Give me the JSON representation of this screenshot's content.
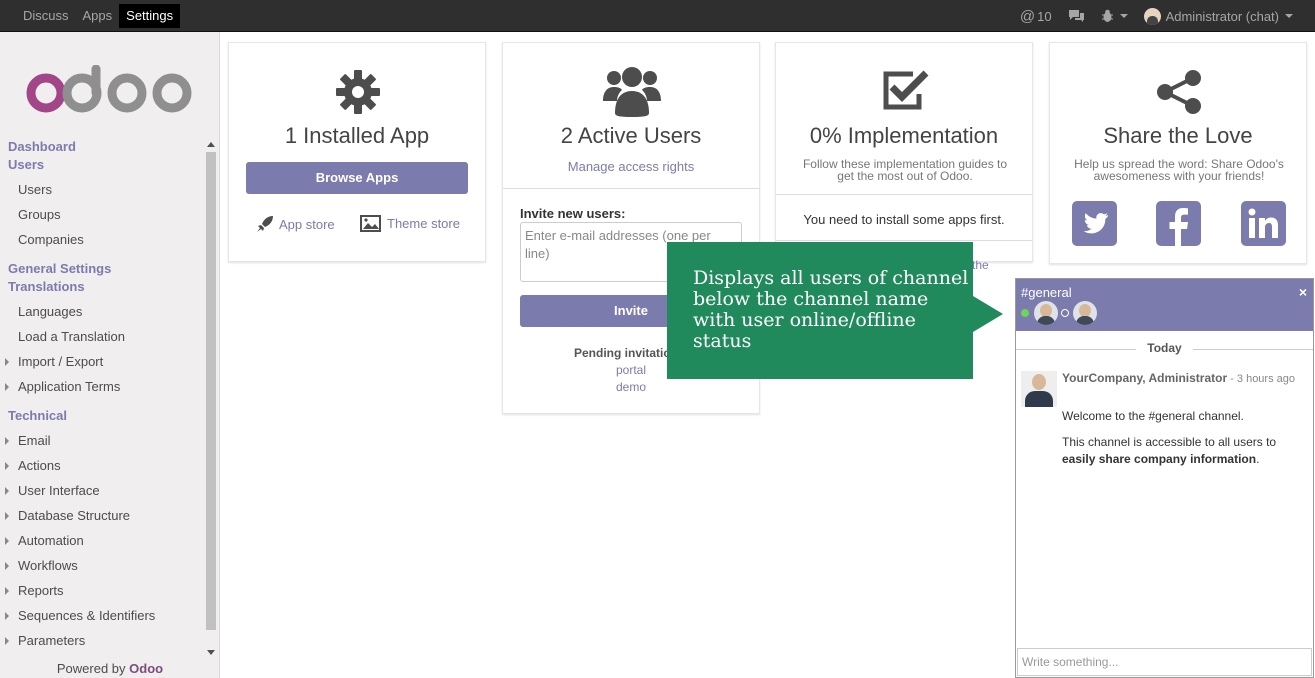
{
  "topbar": {
    "menu": [
      "Discuss",
      "Apps",
      "Settings"
    ],
    "active": "Settings",
    "mentions": "10",
    "user": "Administrator (chat)"
  },
  "sidebar": {
    "logo": "odoo",
    "items": [
      {
        "label": "Dashboard",
        "type": "header"
      },
      {
        "label": "Users",
        "type": "header"
      },
      {
        "label": "Users",
        "type": "item"
      },
      {
        "label": "Groups",
        "type": "item"
      },
      {
        "label": "Companies",
        "type": "item"
      },
      {
        "label": "General Settings",
        "type": "header"
      },
      {
        "label": "Translations",
        "type": "header"
      },
      {
        "label": "Languages",
        "type": "item"
      },
      {
        "label": "Load a Translation",
        "type": "item"
      },
      {
        "label": "Import / Export",
        "type": "expandable"
      },
      {
        "label": "Application Terms",
        "type": "expandable"
      },
      {
        "label": "Technical",
        "type": "header"
      },
      {
        "label": "Email",
        "type": "expandable"
      },
      {
        "label": "Actions",
        "type": "expandable"
      },
      {
        "label": "User Interface",
        "type": "expandable"
      },
      {
        "label": "Database Structure",
        "type": "expandable"
      },
      {
        "label": "Automation",
        "type": "expandable"
      },
      {
        "label": "Workflows",
        "type": "expandable"
      },
      {
        "label": "Reports",
        "type": "expandable"
      },
      {
        "label": "Sequences & Identifiers",
        "type": "expandable"
      },
      {
        "label": "Parameters",
        "type": "expandable"
      }
    ],
    "powered_prefix": "Powered by ",
    "powered_brand": "Odoo"
  },
  "cards": {
    "apps": {
      "title": "1 Installed App",
      "button": "Browse Apps",
      "app_store": "App store",
      "theme_store": "Theme store"
    },
    "users": {
      "title": "2 Active Users",
      "link": "Manage access rights",
      "invite_label": "Invite new users:",
      "invite_placeholder": "Enter e-mail addresses (one per line)",
      "invite_button": "Invite",
      "pending": "Pending invitatio",
      "pending_users": [
        "portal",
        "demo"
      ]
    },
    "impl": {
      "title": "0% Implementation",
      "sub": "Follow these implementation guides to get the most out of Odoo.",
      "msg": "You need to install some apps first.",
      "partial": "the"
    },
    "share": {
      "title": "Share the Love",
      "sub": "Help us spread the word: Share Odoo's awesomeness with your friends!"
    }
  },
  "tooltip": {
    "text": "Displays all users of channel below the channel name with user online/offline status"
  },
  "chat": {
    "channel": "#general",
    "close": "×",
    "day": "Today",
    "author": "YourCompany, Administrator",
    "time": " - 3 hours ago",
    "msg1": "Welcome to the #general channel.",
    "msg2a": "This channel is accessible to all users to ",
    "msg2b": "easily share company information",
    "msg2c": ".",
    "composer_placeholder": "Write something..."
  },
  "colors": {
    "accent": "#7c7bad",
    "tooltip": "#218a5c",
    "online": "#6cd45a"
  }
}
